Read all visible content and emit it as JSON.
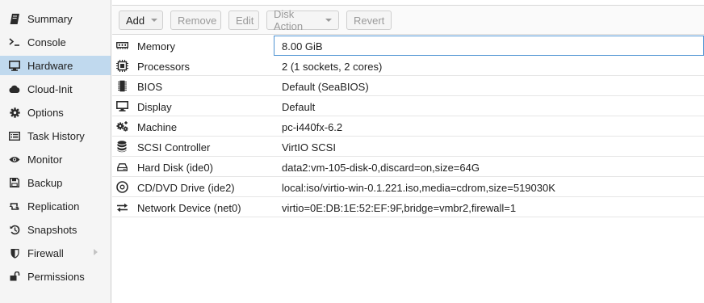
{
  "sidebar": {
    "items": [
      {
        "label": "Summary",
        "icon": "book-icon",
        "active": false
      },
      {
        "label": "Console",
        "icon": "terminal-icon",
        "active": false
      },
      {
        "label": "Hardware",
        "icon": "desktop-icon",
        "active": true
      },
      {
        "label": "Cloud-Init",
        "icon": "cloud-icon",
        "active": false
      },
      {
        "label": "Options",
        "icon": "gear-icon",
        "active": false
      },
      {
        "label": "Task History",
        "icon": "list-icon",
        "active": false
      },
      {
        "label": "Monitor",
        "icon": "eye-icon",
        "active": false
      },
      {
        "label": "Backup",
        "icon": "floppy-icon",
        "active": false
      },
      {
        "label": "Replication",
        "icon": "retweet-icon",
        "active": false
      },
      {
        "label": "Snapshots",
        "icon": "history-icon",
        "active": false
      },
      {
        "label": "Firewall",
        "icon": "shield-icon",
        "active": false,
        "has_submenu": true
      },
      {
        "label": "Permissions",
        "icon": "unlock-icon",
        "active": false
      }
    ]
  },
  "toolbar": {
    "add_label": "Add",
    "remove_label": "Remove",
    "edit_label": "Edit",
    "disk_action_label": "Disk Action",
    "revert_label": "Revert"
  },
  "hardware": {
    "rows": [
      {
        "icon": "memory-icon",
        "label": "Memory",
        "value": "8.00 GiB",
        "selected": true
      },
      {
        "icon": "cpu-icon",
        "label": "Processors",
        "value": "2 (1 sockets, 2 cores)"
      },
      {
        "icon": "chip-icon",
        "label": "BIOS",
        "value": "Default (SeaBIOS)"
      },
      {
        "icon": "desktop-icon",
        "label": "Display",
        "value": "Default"
      },
      {
        "icon": "cogs-icon",
        "label": "Machine",
        "value": "pc-i440fx-6.2"
      },
      {
        "icon": "database-icon",
        "label": "SCSI Controller",
        "value": "VirtIO SCSI"
      },
      {
        "icon": "hdd-icon",
        "label": "Hard Disk (ide0)",
        "value": "data2:vm-105-disk-0,discard=on,size=64G"
      },
      {
        "icon": "cdrom-icon",
        "label": "CD/DVD Drive (ide2)",
        "value": "local:iso/virtio-win-0.1.221.iso,media=cdrom,size=519030K"
      },
      {
        "icon": "exchange-icon",
        "label": "Network Device (net0)",
        "value": "virtio=0E:DB:1E:52:EF:9F,bridge=vmbr2,firewall=1"
      }
    ]
  },
  "colors": {
    "active_nav_bg": "#c0d9ee",
    "selection_border": "#4f94d3",
    "disabled_text": "#9a9a9a"
  }
}
